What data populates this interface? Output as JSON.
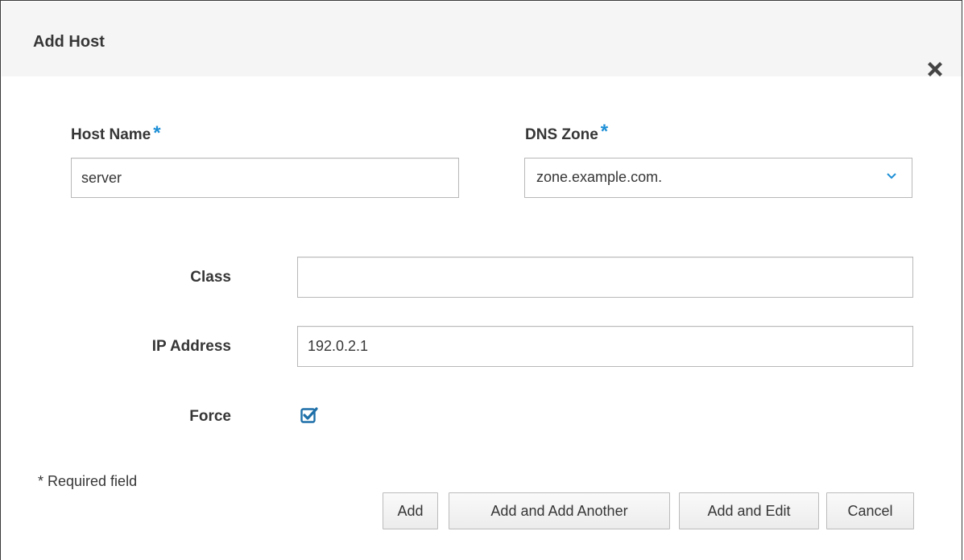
{
  "dialog": {
    "title": "Add Host",
    "close_icon": "close-icon"
  },
  "form": {
    "host_name": {
      "label": "Host Name",
      "required_marker": "*",
      "value": "server"
    },
    "dns_zone": {
      "label": "DNS Zone",
      "required_marker": "*",
      "value": "zone.example.com.",
      "icon": "chevron-down-icon"
    },
    "class": {
      "label": "Class",
      "value": ""
    },
    "ip_address": {
      "label": "IP Address",
      "value": "192.0.2.1"
    },
    "force": {
      "label": "Force",
      "checked": true
    }
  },
  "footer": {
    "required_note": "* Required field",
    "buttons": {
      "add": "Add",
      "add_another": "Add and Add Another",
      "add_edit": "Add and Edit",
      "cancel": "Cancel"
    }
  },
  "colors": {
    "accent": "#1d8fd6",
    "header_bg": "#f5f5f5",
    "text": "#363636"
  }
}
